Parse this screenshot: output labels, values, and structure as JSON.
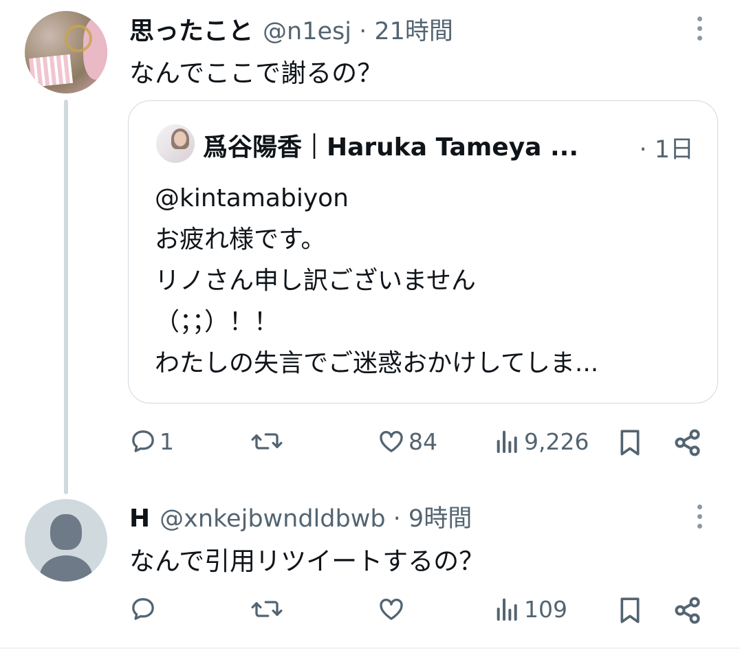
{
  "tweets": [
    {
      "name": "思ったこと",
      "handle": "@n1esj · 21時間",
      "text": "なんでここで謝るの？",
      "quote": {
        "name": "爲谷陽香｜Haruka Tameya ...",
        "time": "· 1日",
        "body": "@kintamabiyon\nお疲れ様です。\nリノさん申し訳ございません\n（；；）！！\nわたしの失言でご迷惑おかけしてしま..."
      },
      "actions": {
        "reply": "1",
        "retweet": "",
        "like": "84",
        "views": "9,226"
      }
    },
    {
      "name": "H",
      "handle": "@xnkejbwndldbwb · 9時間",
      "text": "なんで引用リツイートするの？",
      "actions": {
        "reply": "",
        "retweet": "",
        "like": "",
        "views": "109"
      }
    }
  ],
  "icons": [
    "more-icon",
    "reply-icon",
    "retweet-icon",
    "like-icon",
    "views-icon",
    "bookmark-icon",
    "share-icon"
  ],
  "colors": {
    "text": "#0f1419",
    "secondary": "#536471",
    "border": "#cfd9de"
  }
}
